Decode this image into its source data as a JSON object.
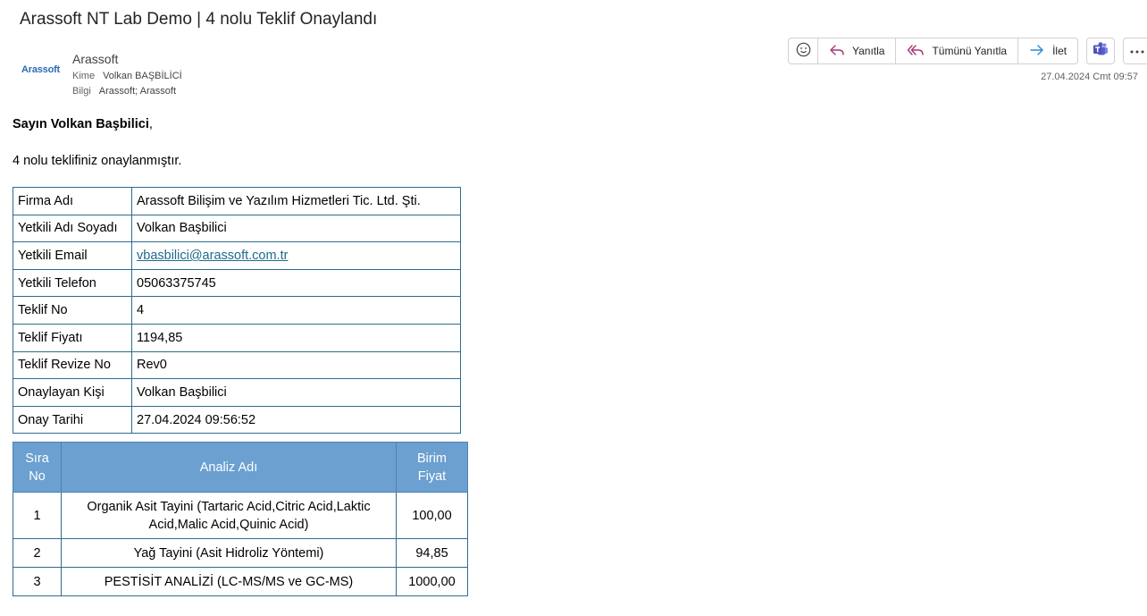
{
  "email": {
    "subject": "Arassoft NT Lab Demo | 4 nolu Teklif Onaylandı",
    "logo_text": "Arassoft",
    "sender_name": "Arassoft",
    "to_label": "Kime",
    "to_value": "Volkan BAŞBİLİCİ",
    "cc_label": "Bilgi",
    "cc_value": "Arassoft; Arassoft",
    "date": "27.04.2024 Cmt 09:57"
  },
  "toolbar": {
    "emoji_icon": "emoji-icon",
    "reply_label": "Yanıtla",
    "reply_all_label": "Tümünü Yanıtla",
    "forward_label": "İlet",
    "teams_icon": "teams-icon",
    "more_icon": "more-icon",
    "reply_color": "#a4377a",
    "forward_color": "#2b88d8"
  },
  "body": {
    "greeting": "Sayın Volkan Başbilici",
    "greeting_suffix": ",",
    "message": "4 nolu teklifiniz onaylanmıştır."
  },
  "info": [
    {
      "label": "Firma Adı",
      "value": "Arassoft Bilişim ve Yazılım Hizmetleri Tic. Ltd. Şti."
    },
    {
      "label": "Yetkili Adı Soyadı",
      "value": "Volkan Başbilici"
    },
    {
      "label": "Yetkili Email",
      "value": "vbasbilici@arassoft.com.tr"
    },
    {
      "label": "Yetkili Telefon",
      "value": "05063375745"
    },
    {
      "label": "Teklif No",
      "value": "4"
    },
    {
      "label": "Teklif Fiyatı",
      "value": "1194,85"
    },
    {
      "label": "Teklif Revize No",
      "value": "Rev0"
    },
    {
      "label": "Onaylayan Kişi",
      "value": "Volkan Başbilici"
    },
    {
      "label": "Onay Tarihi",
      "value": "27.04.2024 09:56:52"
    }
  ],
  "analysis": {
    "headers": {
      "no_line1": "Sıra",
      "no_line2": "No",
      "name": "Analiz Adı",
      "price_line1": "Birim",
      "price_line2": "Fiyat"
    },
    "header_color": "#6ba0d0",
    "rows": [
      {
        "no": "1",
        "name_line1": "Organik Asit Tayini (Tartaric Acid,Citric Acid,Laktic",
        "name_line2": "Acid,Malic Acid,Quinic Acid)",
        "price": "100,00"
      },
      {
        "no": "2",
        "name_line1": "Yağ Tayini (Asit Hidroliz Yöntemi)",
        "name_line2": "",
        "price": "94,85"
      },
      {
        "no": "3",
        "name_line1": "PESTİSİT ANALİZİ (LC-MS/MS ve GC-MS)",
        "name_line2": "",
        "price": "1000,00"
      }
    ]
  }
}
